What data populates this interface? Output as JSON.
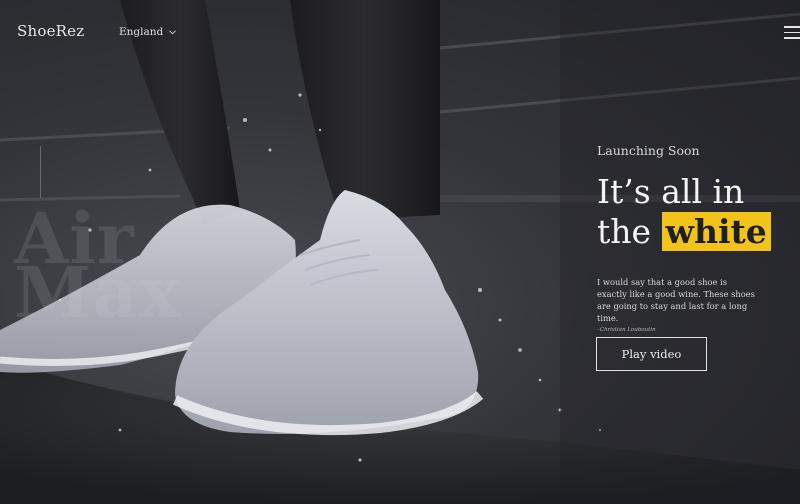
{
  "header": {
    "logo": "ShoeRez",
    "region": "England",
    "chevron_icon": "chevron-down",
    "menu_icon": "hamburger-menu"
  },
  "background": {
    "word_line1": "Air",
    "word_line2": "Max"
  },
  "hero": {
    "eyebrow": "Launching Soon",
    "headline_line1": "It’s all in",
    "headline_prefix": "the",
    "headline_highlight": "white",
    "description": "I would say that a good shoe is exactly like a good wine. These shoes are going to stay and last for a long time.",
    "citation": "–Christian Louboutin",
    "play_button": "Play video"
  },
  "colors": {
    "accent": "#f2c318",
    "background": "#2c2d32",
    "text": "#f4f4f4"
  }
}
